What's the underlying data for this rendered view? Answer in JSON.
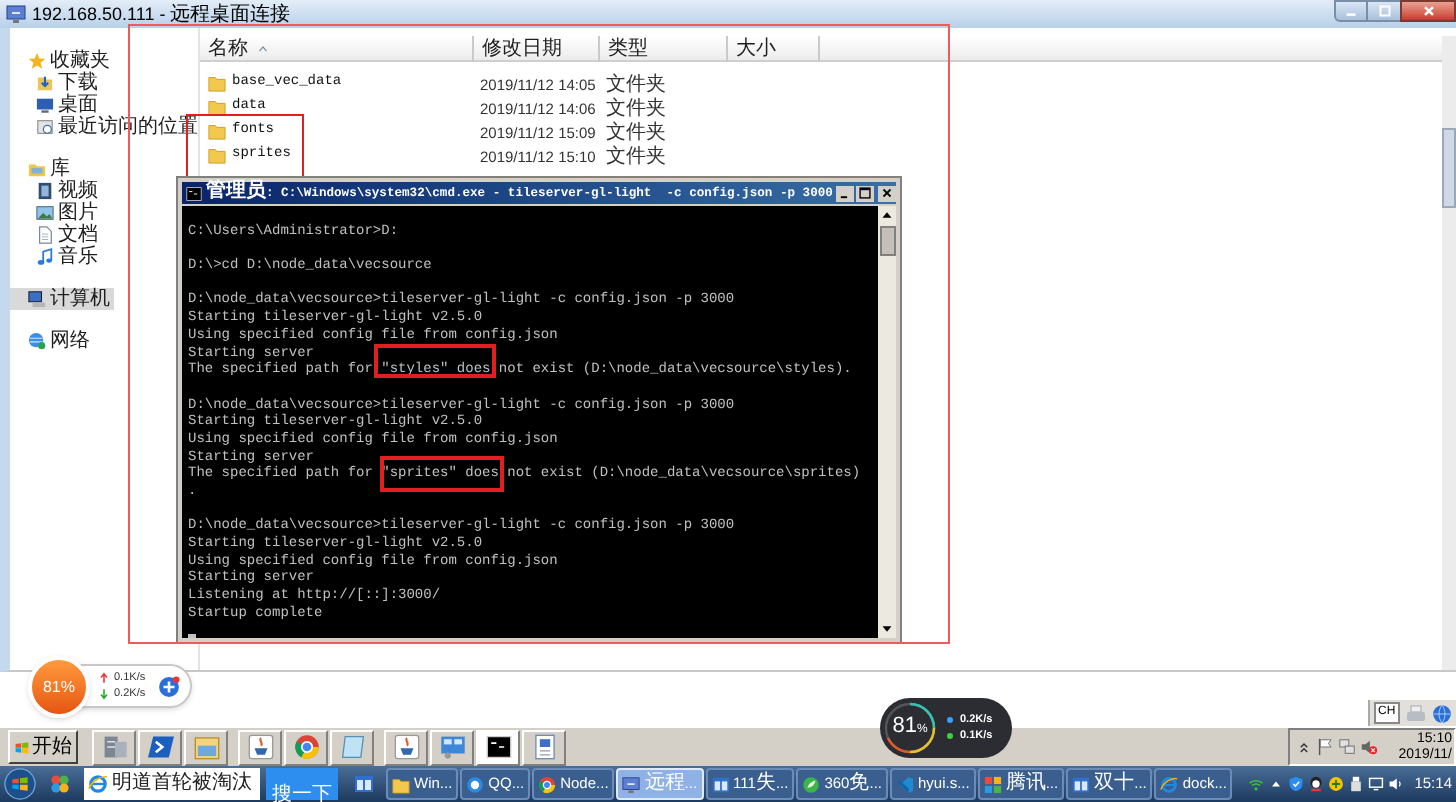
{
  "rdp_window": {
    "title": "192.168.50.111 - 远程桌面连接"
  },
  "explorer": {
    "nav": [
      {
        "label": "收藏夹",
        "selected": false,
        "children": [
          {
            "label": "下载",
            "selected": false
          },
          {
            "label": "桌面",
            "selected": false
          },
          {
            "label": "最近访问的位置",
            "selected": false
          }
        ]
      },
      {
        "label": "库",
        "selected": false,
        "children": [
          {
            "label": "视频",
            "selected": false
          },
          {
            "label": "图片",
            "selected": false
          },
          {
            "label": "文档",
            "selected": false
          },
          {
            "label": "音乐",
            "selected": false
          }
        ]
      },
      {
        "label": "计算机",
        "selected": true
      },
      {
        "label": "网络",
        "selected": false
      }
    ],
    "columns": [
      {
        "label": "名称",
        "sorted": true
      },
      {
        "label": "修改日期",
        "sorted": false
      },
      {
        "label": "类型",
        "sorted": false
      },
      {
        "label": "大小",
        "sorted": false
      }
    ],
    "rows": [
      {
        "name": "base_vec_data",
        "modified": "2019/11/12 14:05",
        "type": "文件夹"
      },
      {
        "name": "data",
        "modified": "2019/11/12 14:06",
        "type": "文件夹"
      },
      {
        "name": "fonts",
        "modified": "2019/11/12 15:09",
        "type": "文件夹"
      },
      {
        "name": "sprites",
        "modified": "2019/11/12 15:10",
        "type": "文件夹"
      }
    ]
  },
  "cmd_window": {
    "title": "管理员: C:\\Windows\\system32\\cmd.exe - tileserver-gl-light  -c config.json -p 3000",
    "blocks": [
      [
        "C:\\Users\\Administrator>D:"
      ],
      [
        "D:\\>cd D:\\node_data\\vecsource"
      ],
      [
        "D:\\node_data\\vecsource>tileserver-gl-light -c config.json -p 3000",
        "Starting tileserver-gl-light v2.5.0",
        "Using specified config file from config.json",
        "Starting server",
        "The specified path for \"styles\" does not exist (D:\\node_data\\vecsource\\styles)."
      ],
      [
        "D:\\node_data\\vecsource>tileserver-gl-light -c config.json -p 3000",
        "Starting tileserver-gl-light v2.5.0",
        "Using specified config file from config.json",
        "Starting server",
        "The specified path for \"sprites\" does not exist (D:\\node_data\\vecsource\\sprites)",
        "."
      ],
      [
        "D:\\node_data\\vecsource>tileserver-gl-light -c config.json -p 3000",
        "Starting tileserver-gl-light v2.5.0",
        "Using specified config file from config.json",
        "Starting server",
        "Listening at http://[::]:3000/",
        "Startup complete"
      ]
    ]
  },
  "widgets": [
    {
      "kind": "ball",
      "percent": "81%",
      "speeds": [
        {
          "kind": "upload",
          "text": "0.1K/s"
        },
        {
          "kind": "download",
          "text": "0.2K/s"
        }
      ]
    },
    {
      "kind": "pill",
      "percent": "81",
      "unit": "%",
      "speeds": [
        {
          "kind": "upload",
          "text": "0.2K/s"
        },
        {
          "kind": "download",
          "text": "0.1K/s"
        }
      ]
    }
  ],
  "remote_taskbar": {
    "start_label": "开始",
    "language": "CH",
    "time": "15:10",
    "date": "2019/11/"
  },
  "taskbar": {
    "search": {
      "value": "明道首轮被淘汰",
      "button": "搜一下"
    },
    "items": [
      {
        "label": "Win...",
        "selected": false
      },
      {
        "label": "QQ...",
        "selected": false
      },
      {
        "label": "Node...",
        "selected": false
      },
      {
        "label": "远程...",
        "selected": true
      },
      {
        "label": "111失...",
        "selected": false
      },
      {
        "label": "360免...",
        "selected": false
      },
      {
        "label": "hyui.s...",
        "selected": false
      },
      {
        "label": "腾讯...",
        "selected": false
      },
      {
        "label": "双十...",
        "selected": false
      },
      {
        "label": "dock...",
        "selected": false
      }
    ],
    "time": "15:14"
  }
}
